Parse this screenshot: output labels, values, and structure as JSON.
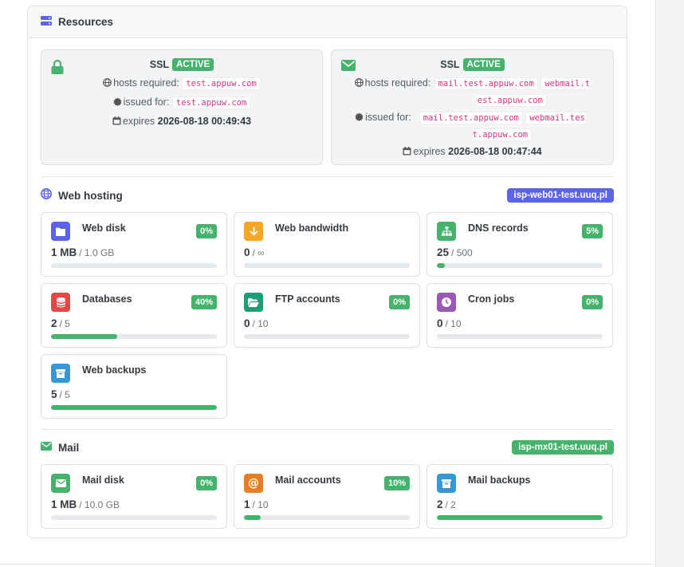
{
  "card": {
    "title": "Resources"
  },
  "ssl": [
    {
      "icon": "lock-icon",
      "label": "SSL",
      "status": "ACTIVE",
      "hosts_label": "hosts required:",
      "hosts": [
        "test.appuw.com"
      ],
      "issued_label": "issued for:",
      "issued": [
        "test.appuw.com"
      ],
      "expires_label": "expires",
      "expires": "2026-08-18 00:49:43"
    },
    {
      "icon": "envelope-icon",
      "label": "SSL",
      "status": "ACTIVE",
      "hosts_label": "hosts required:",
      "hosts": [
        "mail.test.appuw.com",
        "webmail.test.appuw.com"
      ],
      "issued_label": "issued for:",
      "issued": [
        "mail.test.appuw.com",
        "webmail.test.appuw.com"
      ],
      "expires_label": "expires",
      "expires": "2026-08-18 00:47:44"
    }
  ],
  "web": {
    "title": "Web hosting",
    "server": "isp-web01-test.uuq.pl",
    "tiles": [
      {
        "name": "Web disk",
        "icon": "folder-icon",
        "color": "#5b63e8",
        "pct": "0%",
        "used": "1 MB",
        "limit": "/ 1.0 GB",
        "fill": 0
      },
      {
        "name": "Web bandwidth",
        "icon": "arrow-down-icon",
        "color": "#f5a623",
        "pct": "",
        "used": "0",
        "limit": "/ ∞",
        "fill": null
      },
      {
        "name": "DNS records",
        "icon": "sitemap-icon",
        "color": "#45b36b",
        "pct": "5%",
        "used": "25",
        "limit": "/ 500",
        "fill": 5
      },
      {
        "name": "Databases",
        "icon": "database-icon",
        "color": "#e64545",
        "pct": "40%",
        "used": "2",
        "limit": "/ 5",
        "fill": 40
      },
      {
        "name": "FTP accounts",
        "icon": "folder-open-icon",
        "color": "#1a9e76",
        "pct": "0%",
        "used": "0",
        "limit": "/ 10",
        "fill": 0
      },
      {
        "name": "Cron jobs",
        "icon": "clock-icon",
        "color": "#9b59b6",
        "pct": "0%",
        "used": "0",
        "limit": "/ 10",
        "fill": 0
      },
      {
        "name": "Web backups",
        "icon": "archive-icon",
        "color": "#3498db",
        "pct": "",
        "used": "5",
        "limit": "/ 5",
        "fill": 100
      }
    ]
  },
  "mail": {
    "title": "Mail",
    "server": "isp-mx01-test.uuq.pl",
    "tiles": [
      {
        "name": "Mail disk",
        "icon": "envelope-icon",
        "color": "#45b36b",
        "pct": "0%",
        "used": "1 MB",
        "limit": "/ 10.0 GB",
        "fill": 0
      },
      {
        "name": "Mail accounts",
        "icon": "at-icon",
        "color": "#e67e22",
        "pct": "10%",
        "used": "1",
        "limit": "/ 10",
        "fill": 10
      },
      {
        "name": "Mail backups",
        "icon": "archive-icon",
        "color": "#3498db",
        "pct": "",
        "used": "2",
        "limit": "/ 2",
        "fill": 100
      }
    ]
  },
  "colors": {
    "web_server_badge": "#5b63e8",
    "mail_server_badge": "#45b36b",
    "success": "#45b36b"
  }
}
